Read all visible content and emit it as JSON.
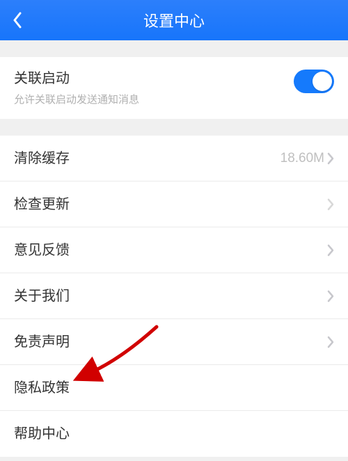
{
  "header": {
    "title": "设置中心"
  },
  "toggle_section": {
    "label": "关联启动",
    "sublabel": "允许关联启动发送通知消息",
    "enabled": true
  },
  "items": {
    "clear_cache": {
      "label": "清除缓存",
      "value": "18.60M",
      "chevron": true
    },
    "check_update": {
      "label": "检查更新",
      "chevron": true
    },
    "feedback": {
      "label": "意见反馈",
      "chevron": true
    },
    "about_us": {
      "label": "关于我们",
      "chevron": true
    },
    "disclaimer": {
      "label": "免责声明",
      "chevron": true
    },
    "privacy": {
      "label": "隐私政策",
      "chevron": false
    },
    "help": {
      "label": "帮助中心",
      "chevron": false
    }
  },
  "annotation": {
    "type": "red-arrow",
    "target": "privacy"
  }
}
